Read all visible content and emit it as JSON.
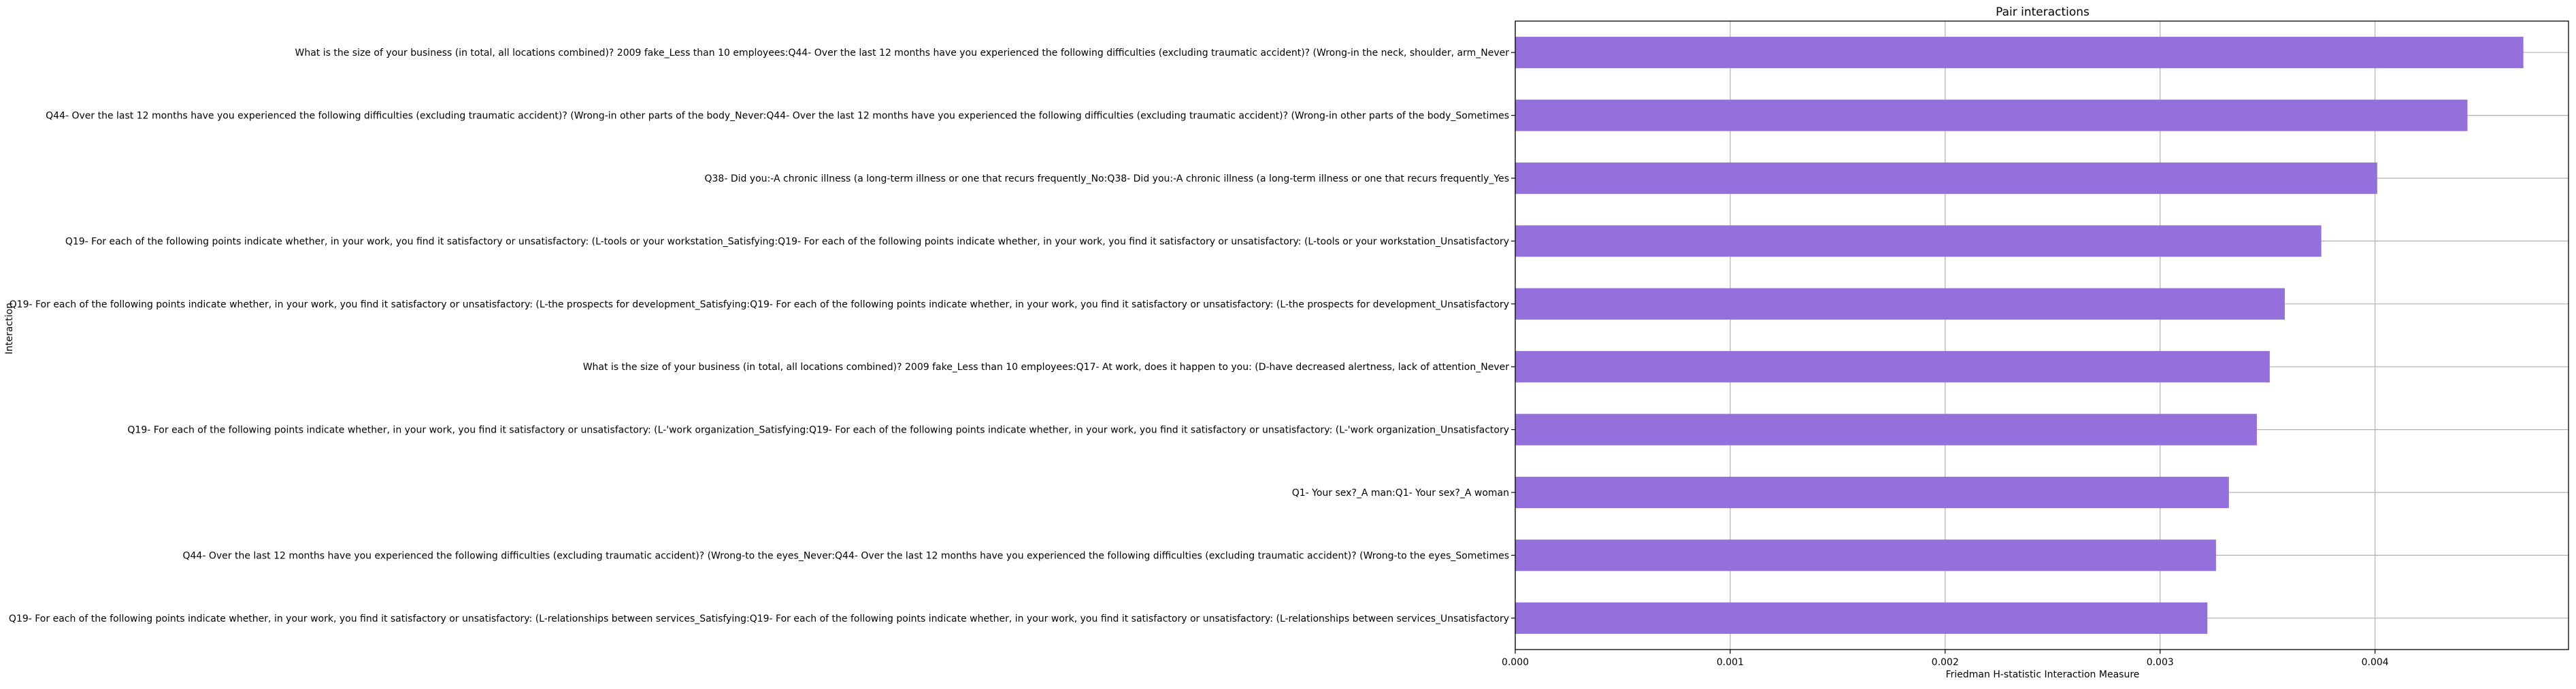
{
  "chart_data": {
    "type": "bar",
    "orientation": "horizontal",
    "title": "Pair interactions",
    "xlabel": "Friedman H-statistic Interaction Measure",
    "ylabel": "Interaction",
    "xlim": [
      0,
      0.0049
    ],
    "xticks": [
      0.0,
      0.001,
      0.002,
      0.003,
      0.004
    ],
    "xtick_labels": [
      "0.000",
      "0.001",
      "0.002",
      "0.003",
      "0.004"
    ],
    "grid": true,
    "bar_color": "#9370db",
    "categories": [
      "What is the size of your business (in total, all locations combined)? 2009 fake_Less than 10 employees:Q44- Over the last 12 months have you experienced the following difficulties (excluding traumatic accident)? (Wrong-in the neck, shoulder, arm_Never",
      "Q44- Over the last 12 months have you experienced the following difficulties (excluding traumatic accident)? (Wrong-in other parts of the body_Never:Q44- Over the last 12 months have you experienced the following difficulties (excluding traumatic accident)? (Wrong-in other parts of the body_Sometimes",
      "Q38- Did you:-A chronic illness (a long-term illness or one that recurs frequently_No:Q38- Did you:-A chronic illness (a long-term illness or one that recurs frequently_Yes",
      "Q19- For each of the following points indicate whether, in your work, you find it satisfactory or unsatisfactory: (L-tools or your workstation_Satisfying:Q19- For each of the following points indicate whether, in your work, you find it satisfactory or unsatisfactory: (L-tools or your workstation_Unsatisfactory",
      "Q19- For each of the following points indicate whether, in your work, you find it satisfactory or unsatisfactory: (L-the prospects for development_Satisfying:Q19- For each of the following points indicate whether, in your work, you find it satisfactory or unsatisfactory: (L-the prospects for development_Unsatisfactory",
      "What is the size of your business (in total, all locations combined)? 2009 fake_Less than 10 employees:Q17- At work, does it happen to you: (D-have decreased alertness, lack of attention_Never",
      "Q19- For each of the following points indicate whether, in your work, you find it satisfactory or unsatisfactory: (L-'work organization_Satisfying:Q19- For each of the following points indicate whether, in your work, you find it satisfactory or unsatisfactory: (L-'work organization_Unsatisfactory",
      "Q1- Your sex?_A man:Q1- Your sex?_A woman",
      "Q44- Over the last 12 months have you experienced the following difficulties (excluding traumatic accident)? (Wrong-to the eyes_Never:Q44- Over the last 12 months have you experienced the following difficulties (excluding traumatic accident)? (Wrong-to the eyes_Sometimes",
      "Q19- For each of the following points indicate whether, in your work, you find it satisfactory or unsatisfactory: (L-relationships between services_Satisfying:Q19- For each of the following points indicate whether, in your work, you find it satisfactory or unsatisfactory: (L-relationships between services_Unsatisfactory"
    ],
    "values": [
      0.00469,
      0.00443,
      0.00401,
      0.00375,
      0.00358,
      0.00351,
      0.00345,
      0.00332,
      0.00326,
      0.00322
    ]
  }
}
